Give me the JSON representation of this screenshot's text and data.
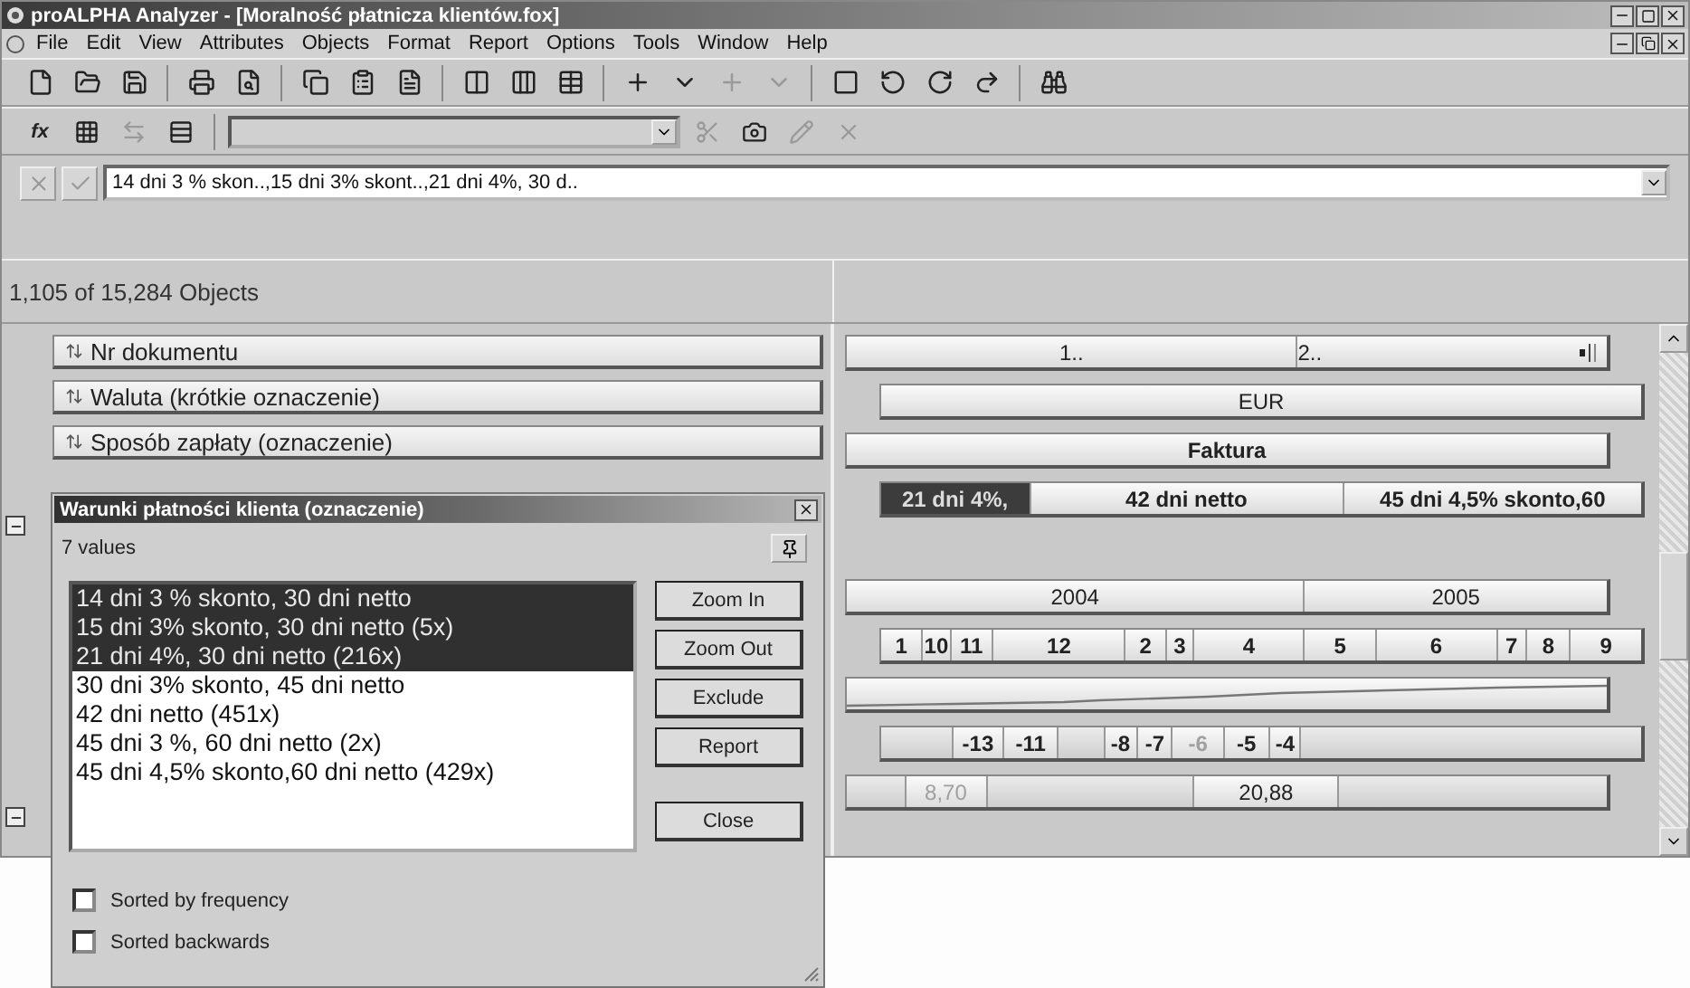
{
  "window": {
    "title": "proALPHA Analyzer - [Moralność płatnicza klientów.fox]"
  },
  "menu": [
    "File",
    "Edit",
    "View",
    "Attributes",
    "Objects",
    "Format",
    "Report",
    "Options",
    "Tools",
    "Window",
    "Help"
  ],
  "function_button": "fx",
  "formula_bar": {
    "value": "14 dni 3 % skon..,15 dni 3% skont..,21 dni 4%, 30 d.."
  },
  "object_count": "1,105 of 15,284 Objects",
  "attributes": [
    {
      "label": "Nr dokumentu"
    },
    {
      "label": "Waluta (krótkie oznaczenie)"
    },
    {
      "label": "Sposób zapłaty (oznaczenie)"
    }
  ],
  "value_rows": [
    {
      "kind": "header",
      "segments": [
        {
          "text": "1.."
        },
        {
          "text": "2.."
        }
      ]
    },
    {
      "kind": "bar",
      "segments": [
        {
          "text": "EUR"
        }
      ]
    },
    {
      "kind": "bar",
      "bold": true,
      "segments": [
        {
          "text": "Faktura"
        }
      ]
    },
    {
      "kind": "bar",
      "bold": true,
      "segments": [
        {
          "text": "21 dni 4%,",
          "selected": true
        },
        {
          "text": "42 dni netto",
          "selected": false
        },
        {
          "text": "45 dni 4,5% skonto,60",
          "selected": false
        }
      ]
    },
    {
      "kind": "empty"
    },
    {
      "kind": "bar",
      "segments": [
        {
          "text": "2004"
        },
        {
          "text": "2005"
        }
      ]
    },
    {
      "kind": "bar",
      "bold": true,
      "segments": [
        {
          "text": "1"
        },
        {
          "text": "10"
        },
        {
          "text": "11"
        },
        {
          "text": "12"
        },
        {
          "text": "2"
        },
        {
          "text": "3"
        },
        {
          "text": "4"
        },
        {
          "text": "5"
        },
        {
          "text": "6"
        },
        {
          "text": "7"
        },
        {
          "text": "8"
        },
        {
          "text": "9"
        }
      ]
    },
    {
      "kind": "sparkline"
    },
    {
      "kind": "bar",
      "bold": true,
      "segments": [
        {
          "kind": "blank"
        },
        {
          "text": "-13",
          "dimmed": false
        },
        {
          "text": "-11",
          "dimmed": false
        },
        {
          "kind": "blank"
        },
        {
          "text": "-8",
          "dimmed": false
        },
        {
          "text": "-7",
          "dimmed": false
        },
        {
          "text": "-6",
          "dimmed": true
        },
        {
          "text": "-5",
          "dimmed": false
        },
        {
          "text": "-4",
          "dimmed": false
        },
        {
          "kind": "blank"
        }
      ]
    },
    {
      "kind": "bar",
      "segments": [
        {
          "kind": "blank"
        },
        {
          "text": "8,70",
          "dimmed": true
        },
        {
          "kind": "blank"
        },
        {
          "text": "20,88",
          "dimmed": false
        },
        {
          "kind": "blank"
        }
      ]
    }
  ],
  "dialog": {
    "title": "Warunki płatności klienta (oznaczenie)",
    "count": "7 values",
    "values": [
      {
        "text": "14 dni 3 % skonto, 30 dni netto",
        "selected": true
      },
      {
        "text": "15 dni 3% skonto, 30 dni netto   (5x)",
        "selected": true
      },
      {
        "text": "21 dni 4%, 30 dni netto   (216x)",
        "selected": true
      },
      {
        "text": "30 dni 3% skonto, 45 dni netto",
        "selected": false
      },
      {
        "text": "42 dni netto   (451x)",
        "selected": false
      },
      {
        "text": "45 dni 3 %, 60 dni netto   (2x)",
        "selected": false
      },
      {
        "text": "45 dni 4,5% skonto,60 dni netto   (429x)",
        "selected": false
      }
    ],
    "buttons": [
      "Zoom In",
      "Zoom Out",
      "Exclude",
      "Report",
      "Close"
    ],
    "options": [
      {
        "label": "Sorted by frequency",
        "checked": false
      },
      {
        "label": "Sorted backwards",
        "checked": false
      }
    ]
  }
}
